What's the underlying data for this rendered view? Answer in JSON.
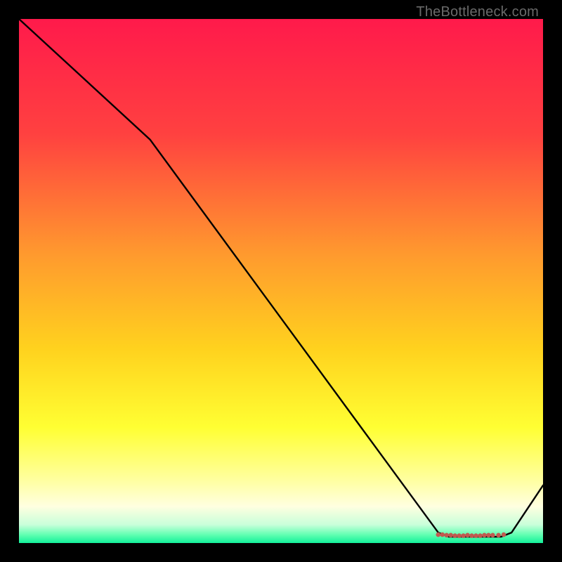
{
  "attribution": "TheBottleneck.com",
  "chart_data": {
    "type": "line",
    "title": "",
    "xlabel": "",
    "ylabel": "",
    "xlim": [
      0,
      100
    ],
    "ylim": [
      0,
      100
    ],
    "gradient_stops": [
      {
        "offset": 0,
        "color": "#ff1a4b"
      },
      {
        "offset": 22,
        "color": "#ff4140"
      },
      {
        "offset": 45,
        "color": "#ff9a2e"
      },
      {
        "offset": 63,
        "color": "#ffd21e"
      },
      {
        "offset": 78,
        "color": "#ffff33"
      },
      {
        "offset": 88,
        "color": "#ffffa0"
      },
      {
        "offset": 93,
        "color": "#ffffe0"
      },
      {
        "offset": 96.5,
        "color": "#c9ffda"
      },
      {
        "offset": 98.5,
        "color": "#5dffb0"
      },
      {
        "offset": 100,
        "color": "#12f09a"
      }
    ],
    "series": [
      {
        "name": "curve",
        "points": [
          {
            "x": 0.0,
            "y": 100.0
          },
          {
            "x": 25.0,
            "y": 77.0
          },
          {
            "x": 80.0,
            "y": 2.0
          },
          {
            "x": 82.0,
            "y": 1.2
          },
          {
            "x": 92.0,
            "y": 1.2
          },
          {
            "x": 94.0,
            "y": 2.0
          },
          {
            "x": 100.0,
            "y": 11.0
          }
        ]
      }
    ],
    "markers": {
      "name": "dense-band",
      "color": "#c05a50",
      "points": [
        {
          "x": 80.0,
          "y": 1.6
        },
        {
          "x": 80.8,
          "y": 1.6
        },
        {
          "x": 81.6,
          "y": 1.5
        },
        {
          "x": 82.4,
          "y": 1.5
        },
        {
          "x": 83.2,
          "y": 1.4
        },
        {
          "x": 84.0,
          "y": 1.4
        },
        {
          "x": 84.8,
          "y": 1.4
        },
        {
          "x": 85.6,
          "y": 1.5
        },
        {
          "x": 86.4,
          "y": 1.4
        },
        {
          "x": 87.2,
          "y": 1.4
        },
        {
          "x": 88.0,
          "y": 1.4
        },
        {
          "x": 88.8,
          "y": 1.5
        },
        {
          "x": 89.6,
          "y": 1.5
        },
        {
          "x": 90.4,
          "y": 1.5
        },
        {
          "x": 91.5,
          "y": 1.5
        },
        {
          "x": 92.5,
          "y": 1.6
        }
      ]
    }
  }
}
